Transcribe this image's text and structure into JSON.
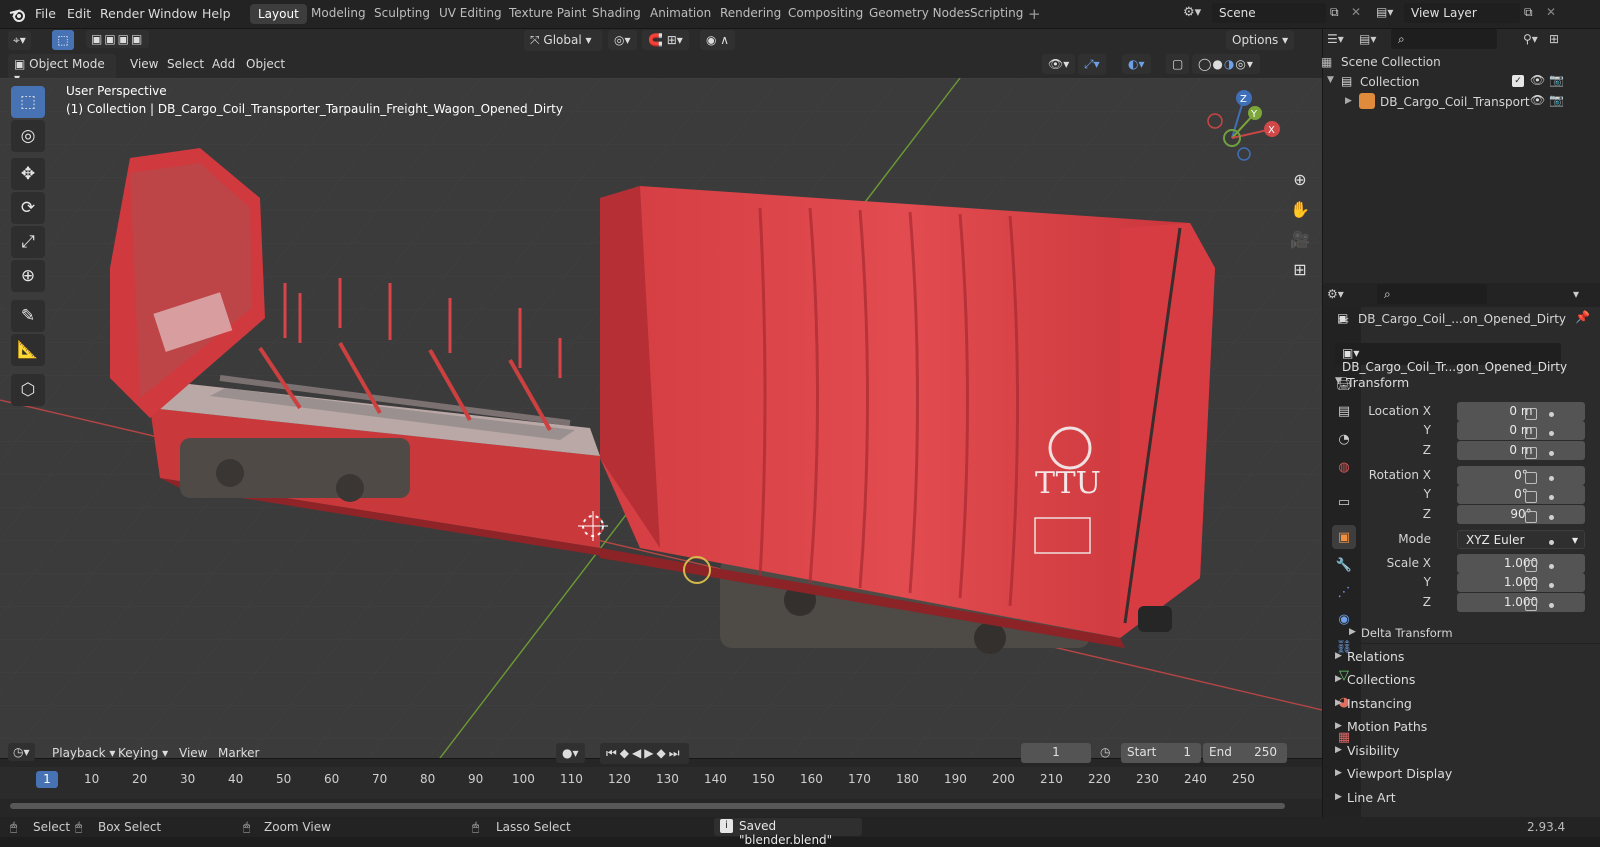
{
  "menu": [
    "File",
    "Edit",
    "Render",
    "Window",
    "Help"
  ],
  "workspaces": [
    "Layout",
    "Modeling",
    "Sculpting",
    "UV Editing",
    "Texture Paint",
    "Shading",
    "Animation",
    "Rendering",
    "Compositing",
    "Geometry Nodes",
    "Scripting"
  ],
  "active_workspace": "Layout",
  "scene_name": "Scene",
  "view_layer": "View Layer",
  "header": {
    "mode": "Object Mode",
    "view": "View",
    "select": "Select",
    "add": "Add",
    "object": "Object",
    "orientation": "Global",
    "options": "Options"
  },
  "viewport": {
    "perspective": "User Perspective",
    "collection_label": "(1) Collection | DB_Cargo_Coil_Transporter_Tarpaulin_Freight_Wagon_Opened_Dirty",
    "wagon_text": "TTU"
  },
  "gizmo": {
    "x": "X",
    "y": "Y",
    "z": "Z"
  },
  "outliner": {
    "scene_collection": "Scene Collection",
    "collection": "Collection",
    "object": "DB_Cargo_Coil_Transport"
  },
  "properties": {
    "object_name": "DB_Cargo_Coil_...on_Opened_Dirty",
    "data_name": "DB_Cargo_Coil_Tr...gon_Opened_Dirty",
    "transform_title": "Transform",
    "location_x_label": "Location X",
    "rotation_x_label": "Rotation X",
    "scale_x_label": "Scale X",
    "y_label": "Y",
    "z_label": "Z",
    "location": [
      "0 m",
      "0 m",
      "0 m"
    ],
    "rotation": [
      "0°",
      "0°",
      "90°"
    ],
    "mode_label": "Mode",
    "mode_value": "XYZ Euler",
    "scale": [
      "1.000",
      "1.000",
      "1.000"
    ],
    "delta": "Delta Transform",
    "sections": [
      "Relations",
      "Collections",
      "Instancing",
      "Motion Paths",
      "Visibility",
      "Viewport Display",
      "Line Art"
    ]
  },
  "timeline": {
    "playback": "Playback",
    "keying": "Keying",
    "view": "View",
    "marker": "Marker",
    "current_frame": "1",
    "start_label": "Start",
    "start": "1",
    "end_label": "End",
    "end": "250",
    "ticks": [
      "1",
      "10",
      "20",
      "30",
      "40",
      "50",
      "60",
      "70",
      "80",
      "90",
      "100",
      "110",
      "120",
      "130",
      "140",
      "150",
      "160",
      "170",
      "180",
      "190",
      "200",
      "210",
      "220",
      "230",
      "240",
      "250"
    ]
  },
  "status": {
    "select": "Select",
    "box_select": "Box Select",
    "zoom_view": "Zoom View",
    "lasso_select": "Lasso Select",
    "saved": "Saved \"blender.blend\"",
    "version": "2.93.4"
  },
  "colors": {
    "accent": "#4772b3",
    "wagon_red": "#d8393c",
    "grid_bg": "#3b3b3b",
    "axis_x": "#d44a4a",
    "axis_y": "#7aa63a"
  }
}
